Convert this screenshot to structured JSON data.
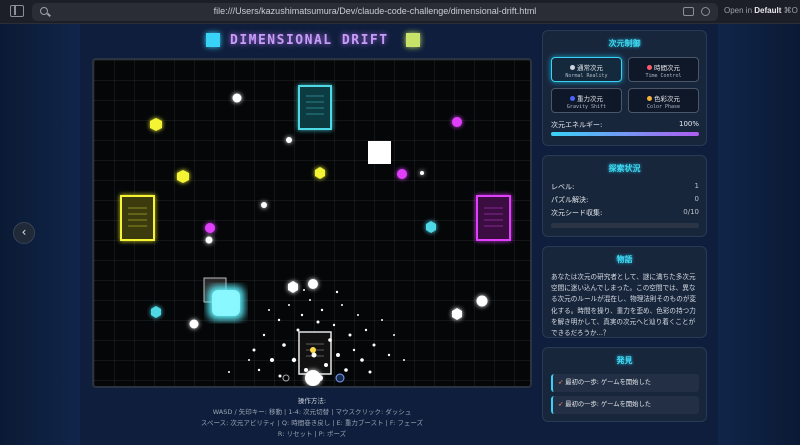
{
  "browser": {
    "url": "file:///Users/kazushimatsumura/Dev/claude-code-challenge/dimensional-drift.html",
    "open_in_prefix": "Open in",
    "open_in_target": "Default",
    "open_in_shortcut": "⌘O"
  },
  "game": {
    "title": "DIMENSIONAL DRIFT",
    "colors": {
      "cyan": "#38d3f7",
      "magenta": "#e040fb",
      "yellow": "#f4f434",
      "white": "#ffffff"
    }
  },
  "controls": {
    "title": "操作方法:",
    "line1": "WASD / 矢印キー: 移動 | 1-4: 次元切替 | マウスクリック: ダッシュ",
    "line2": "スペース: 次元アビリティ | Q: 時間巻き戻し | E: 重力ブースト | F: フェーズ",
    "line3": "R: リセット | P: ポーズ"
  },
  "panels": {
    "dimension": {
      "title": "次元制御",
      "buttons": [
        {
          "label": "通常次元",
          "sub": "Normal Reality",
          "icon": "star-icon",
          "icon_color": "#cfd6e0",
          "active": true
        },
        {
          "label": "時間次元",
          "sub": "Time Control",
          "icon": "clock-icon",
          "icon_color": "#ff5b6e",
          "active": false
        },
        {
          "label": "重力次元",
          "sub": "Gravity Shift",
          "icon": "gravity-icon",
          "icon_color": "#4a63ff",
          "active": false
        },
        {
          "label": "色彩次元",
          "sub": "Color Phase",
          "icon": "palette-icon",
          "icon_color": "#f2b13a",
          "active": false
        }
      ],
      "energy_label": "次元エネルギー:",
      "energy_value": "100%",
      "energy_fraction": 1.0
    },
    "status": {
      "title": "探索状況",
      "level_label": "レベル:",
      "level_value": "1",
      "puzzles_label": "パズル解決:",
      "puzzles_value": "0",
      "seeds_label": "次元シード収集:",
      "seeds_value": "0/10",
      "seeds_fraction": 0.0
    },
    "story": {
      "title": "物語",
      "text": "あなたは次元の研究者として、謎に満ちた多次元空間に迷い込んでしまった。この空間では、異なる次元のルールが混在し、物理法則そのものが変化する。時間を操り、重力を歪め、色彩の持つ力を解き明かして、真実の次元へと辿り着くことができるだろうか...？"
    },
    "discoveries": {
      "title": "発見",
      "items": [
        "最初の一歩: ゲームを開始した",
        "最初の一歩: ゲームを開始した"
      ]
    }
  }
}
